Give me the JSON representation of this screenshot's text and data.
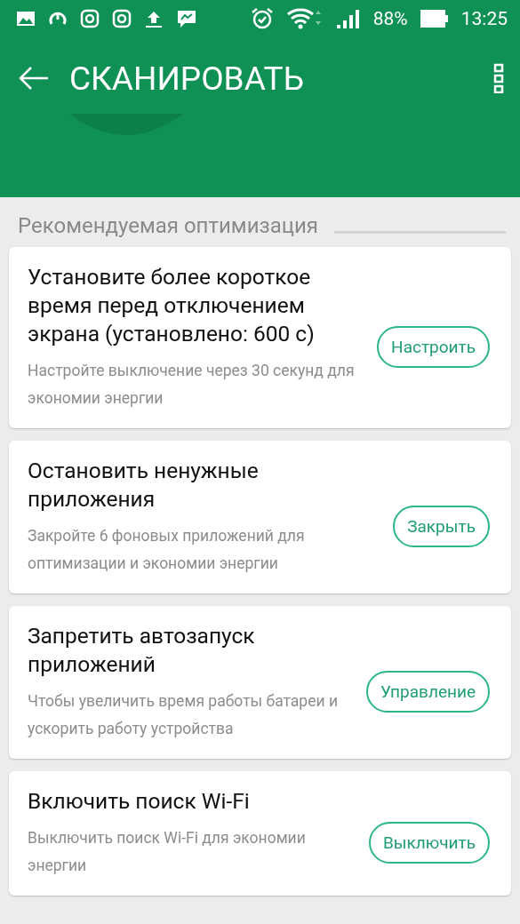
{
  "status_bar": {
    "battery": "88%",
    "time": "13:25"
  },
  "toolbar": {
    "title": "СКАНИРОВАТЬ"
  },
  "section": {
    "title": "Рекомендуемая оптимизация"
  },
  "cards": [
    {
      "title": "Установите более короткое время перед отключением экрана (установлено: 600 с)",
      "description": "Настройте выключение через 30 секунд для экономии энергии",
      "button": "Настроить"
    },
    {
      "title": "Остановить ненужные приложения",
      "description": "Закройте 6 фоновых приложений для оптимизации и экономии энергии",
      "button": "Закрыть"
    },
    {
      "title": "Запретить автозапуск приложений",
      "description": "Чтобы увеличить время работы батареи и ускорить работу устройства",
      "button": "Управление"
    },
    {
      "title": "Включить поиск Wi-Fi",
      "description": "Выключить поиск Wi-Fi для экономии энергии",
      "button": "Выключить"
    }
  ]
}
